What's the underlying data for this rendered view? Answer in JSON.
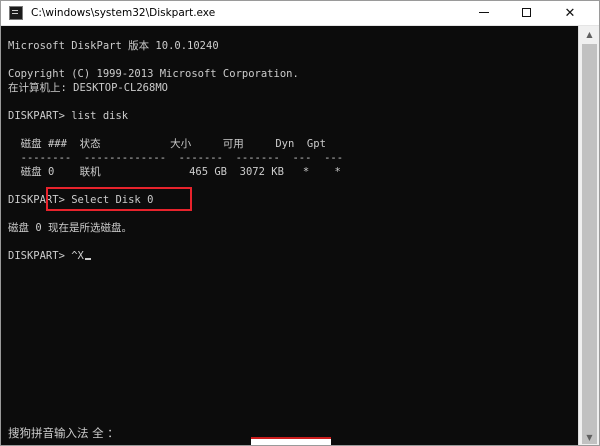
{
  "window": {
    "title": "C:\\windows\\system32\\Diskpart.exe",
    "minimize_label": "—",
    "maximize_label": "☐",
    "close_label": "✕"
  },
  "console": {
    "lines": [
      "Microsoft DiskPart 版本 10.0.10240",
      "",
      "Copyright (C) 1999-2013 Microsoft Corporation.",
      "在计算机上: DESKTOP-CL268MO",
      "",
      "DISKPART> list disk",
      "",
      "  磁盘 ###  状态           大小     可用     Dyn  Gpt",
      "  --------  -------------  -------  -------  ---  ---",
      "  磁盘 0    联机              465 GB  3072 KB   *    *",
      "",
      "DISKPART> Select Disk 0",
      "",
      "磁盘 0 现在是所选磁盘。",
      "",
      "DISKPART> ^X"
    ]
  },
  "ime": {
    "status": "搜狗拼音输入法 全 ："
  },
  "colors": {
    "console_bg": "#0c0c0c",
    "console_text": "#cccccc",
    "highlight": "#e8232c"
  },
  "icons": {
    "app": "console-icon",
    "scroll_up": "arrow-up-icon",
    "scroll_down": "arrow-down-icon"
  }
}
